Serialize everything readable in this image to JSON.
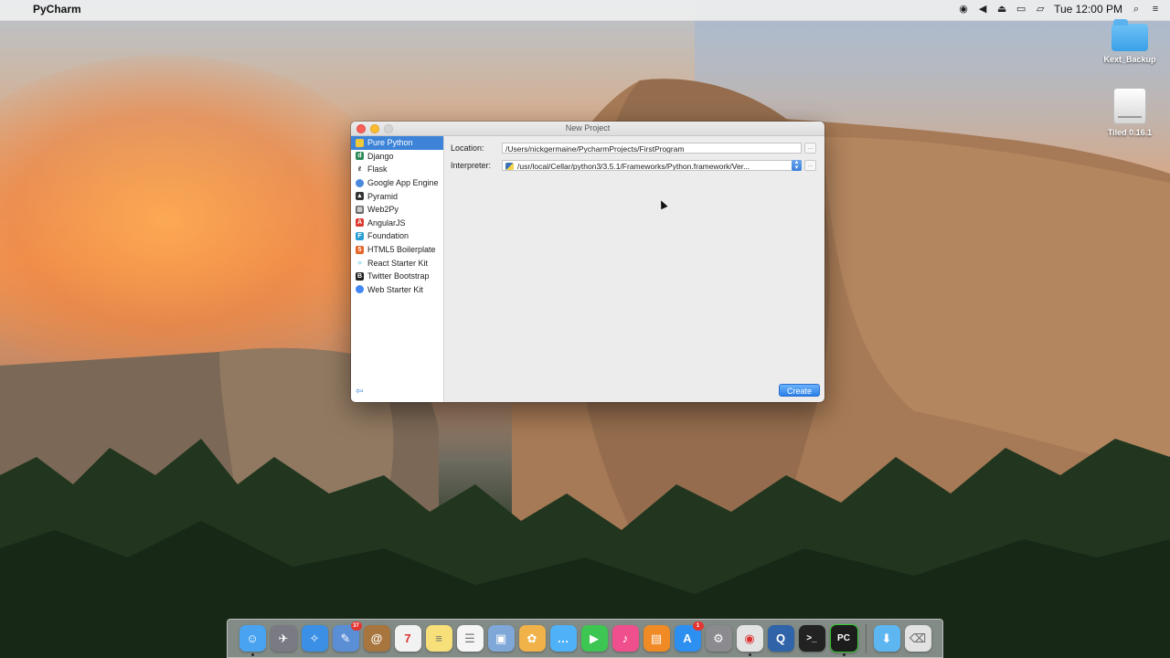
{
  "menubar": {
    "app_name": "PyCharm",
    "clock": "Tue 12:00 PM",
    "status_icons": [
      "record-icon",
      "volume-icon",
      "eject-icon",
      "display-icon",
      "airplay-icon",
      "search-icon",
      "list-icon"
    ]
  },
  "desktop": {
    "icons": [
      {
        "label": "Kext_Backup",
        "type": "folder"
      },
      {
        "label": "Tiled 0.16.1",
        "type": "disk"
      }
    ]
  },
  "dialog": {
    "title": "New Project",
    "project_types": [
      {
        "label": "Pure Python",
        "icon": "python-icon",
        "color": "#f0c93a",
        "selected": true
      },
      {
        "label": "Django",
        "icon": "django-icon",
        "color": "#2e8b57"
      },
      {
        "label": "Flask",
        "icon": "flask-icon",
        "color": "#333333"
      },
      {
        "label": "Google App Engine",
        "icon": "app-engine-icon",
        "color": "#4a89dc"
      },
      {
        "label": "Pyramid",
        "icon": "pyramid-icon",
        "color": "#333333"
      },
      {
        "label": "Web2Py",
        "icon": "web2py-icon",
        "color": "#666666"
      },
      {
        "label": "AngularJS",
        "icon": "angularjs-icon",
        "color": "#dd3b31"
      },
      {
        "label": "Foundation",
        "icon": "foundation-icon",
        "color": "#2a9fd6"
      },
      {
        "label": "HTML5 Boilerplate",
        "icon": "html5-icon",
        "color": "#e8652a"
      },
      {
        "label": "React Starter Kit",
        "icon": "react-icon",
        "color": "#4ac2e8"
      },
      {
        "label": "Twitter Bootstrap",
        "icon": "bootstrap-icon",
        "color": "#222222"
      },
      {
        "label": "Web Starter Kit",
        "icon": "web-starter-kit-icon",
        "color": "#4285f4"
      }
    ],
    "location_label": "Location:",
    "location_value": "/Users/nickgermaine/PycharmProjects/FirstProgram",
    "interpreter_label": "Interpreter:",
    "interpreter_value": "/usr/local/Cellar/python3/3.5.1/Frameworks/Python.framework/Ver...",
    "browse_label": "...",
    "create_label": "Create"
  },
  "dock": {
    "apps": [
      {
        "name": "finder-icon",
        "color": "#4aa3f0",
        "glyph": "☺",
        "running": true
      },
      {
        "name": "launchpad-icon",
        "color": "#7a7a85",
        "glyph": "✈"
      },
      {
        "name": "safari-icon",
        "color": "#3b8fe5",
        "glyph": "✧"
      },
      {
        "name": "photo-preview-icon",
        "color": "#5a8fd6",
        "glyph": "✎",
        "badge": "37"
      },
      {
        "name": "contacts-icon",
        "color": "#a8753e",
        "glyph": "@"
      },
      {
        "name": "calendar-icon",
        "color": "#f2f2f2",
        "glyph": "7"
      },
      {
        "name": "notes-icon",
        "color": "#f7e07a",
        "glyph": "≡"
      },
      {
        "name": "reminders-icon",
        "color": "#f5f5f5",
        "glyph": "☰"
      },
      {
        "name": "preview-icon",
        "color": "#7fa7d8",
        "glyph": "▣"
      },
      {
        "name": "photos-icon",
        "color": "#f1b24a",
        "glyph": "✿"
      },
      {
        "name": "messages-icon",
        "color": "#4fb1f7",
        "glyph": "…"
      },
      {
        "name": "facetime-icon",
        "color": "#3dc651",
        "glyph": "▶"
      },
      {
        "name": "itunes-icon",
        "color": "#f04f8e",
        "glyph": "♪"
      },
      {
        "name": "ibooks-icon",
        "color": "#f08a24",
        "glyph": "▤"
      },
      {
        "name": "app-store-icon",
        "color": "#2d8ff0",
        "glyph": "A",
        "badge": "1"
      },
      {
        "name": "system-preferences-icon",
        "color": "#8a8a8f",
        "glyph": "⚙"
      },
      {
        "name": "chrome-icon",
        "color": "#e3e3e3",
        "glyph": "◉",
        "running": true
      },
      {
        "name": "quicktime-icon",
        "color": "#2f64a8",
        "glyph": "Q"
      },
      {
        "name": "terminal-icon",
        "color": "#222222",
        "glyph": ">_"
      },
      {
        "name": "pycharm-icon",
        "color": "#1c1c1c",
        "glyph": "PC",
        "running": true
      }
    ],
    "right_items": [
      {
        "name": "downloads-folder-icon",
        "color": "#5eb6f1",
        "glyph": "⬇"
      },
      {
        "name": "trash-icon",
        "color": "#e2e2e2",
        "glyph": "🗑"
      }
    ]
  }
}
